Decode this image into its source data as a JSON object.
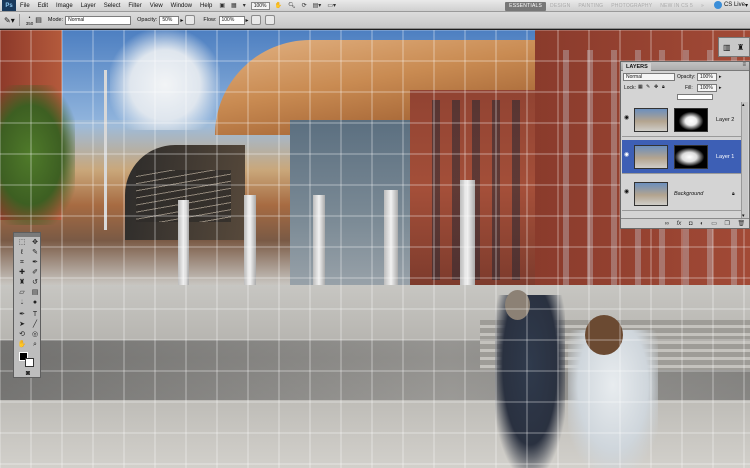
{
  "menubar": {
    "logo": "Ps",
    "menus": [
      "File",
      "Edit",
      "Image",
      "Layer",
      "Select",
      "Filter",
      "View",
      "Window",
      "Help"
    ],
    "zoom_value": "100%",
    "workspaces": [
      "ESSENTIALS",
      "DESIGN",
      "PAINTING",
      "PHOTOGRAPHY",
      "NEW IN CS 5"
    ],
    "active_workspace": "ESSENTIALS",
    "cs_live": "CS Live"
  },
  "options": {
    "brush_size": "350",
    "mode_label": "Mode:",
    "mode_value": "Normal",
    "opacity_label": "Opacity:",
    "opacity_value": "50%",
    "flow_label": "Flow:",
    "flow_value": "100%"
  },
  "layers_panel": {
    "tab": "LAYERS",
    "blend_mode": "Normal",
    "opacity_label": "Opacity:",
    "opacity_value": "100%",
    "lock_label": "Lock:",
    "fill_label": "Fill:",
    "fill_value": "100%",
    "layers": [
      {
        "name": "Layer 2",
        "selected": false
      },
      {
        "name": "Layer 1",
        "selected": true
      },
      {
        "name": "Background",
        "selected": false
      }
    ],
    "footer_icons": [
      "link-icon",
      "fx-icon",
      "mask-icon",
      "adjustment-icon",
      "folder-icon",
      "new-layer-icon",
      "trash-icon"
    ]
  },
  "colors": {
    "selection": "#3d5fb5",
    "ui_gray": "#d4d4d4"
  }
}
